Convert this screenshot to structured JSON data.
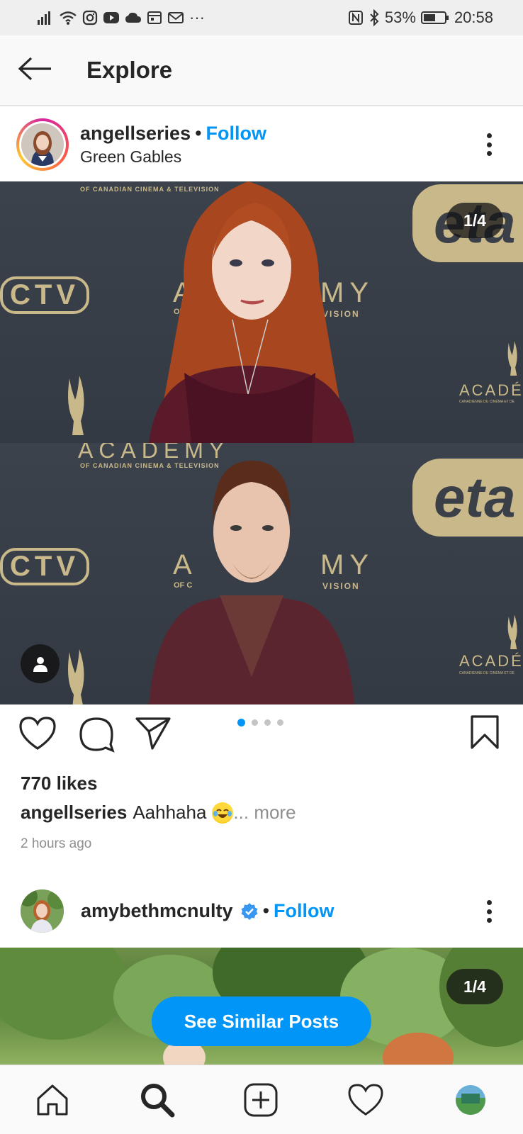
{
  "status_bar": {
    "battery_percent": "53%",
    "time": "20:58",
    "more_indicator": "···",
    "icons": [
      "signal-icon",
      "wifi-icon",
      "instagram-icon",
      "youtube-icon",
      "cloud-icon",
      "calendar-icon",
      "gmail-icon",
      "nfc-icon",
      "bluetooth-icon",
      "battery-icon"
    ]
  },
  "header": {
    "title": "Explore",
    "back_icon": "back-arrow-icon"
  },
  "post1": {
    "username": "angellseries",
    "separator": "•",
    "follow_label": "Follow",
    "location": "Green Gables",
    "counter": "1/4",
    "backdrop": {
      "top_small_text": "OF CANADIAN CINEMA & TELEVISION",
      "ctv": "CTV",
      "academy_a": "A",
      "academy_y": "MY",
      "of_c": "OF C",
      "vision": "VISION",
      "acad_right": "ACADÉ",
      "acad_right_small": "CANADIENNE DU CINÉMA ET DE",
      "panel2_academy": "ACADEMY",
      "eta": "eta"
    },
    "likes": "770 likes",
    "caption_username": "angellseries",
    "caption_text": "Aahhaha",
    "caption_more": "... more",
    "time_ago": "2 hours ago",
    "carousel_pages": 4,
    "carousel_active": 1
  },
  "post2": {
    "username": "amybethmcnulty",
    "separator": "•",
    "follow_label": "Follow",
    "counter": "1/4",
    "verified": true
  },
  "similar_button": "See Similar Posts",
  "bottom_nav": {
    "items": [
      "home-icon",
      "search-icon",
      "add-post-icon",
      "activity-heart-icon",
      "profile-avatar"
    ]
  },
  "colors": {
    "accent": "#0095f6",
    "text": "#262626",
    "muted": "#8e8e8e",
    "backdrop": "#3a4048",
    "gold": "#c9b98a"
  }
}
